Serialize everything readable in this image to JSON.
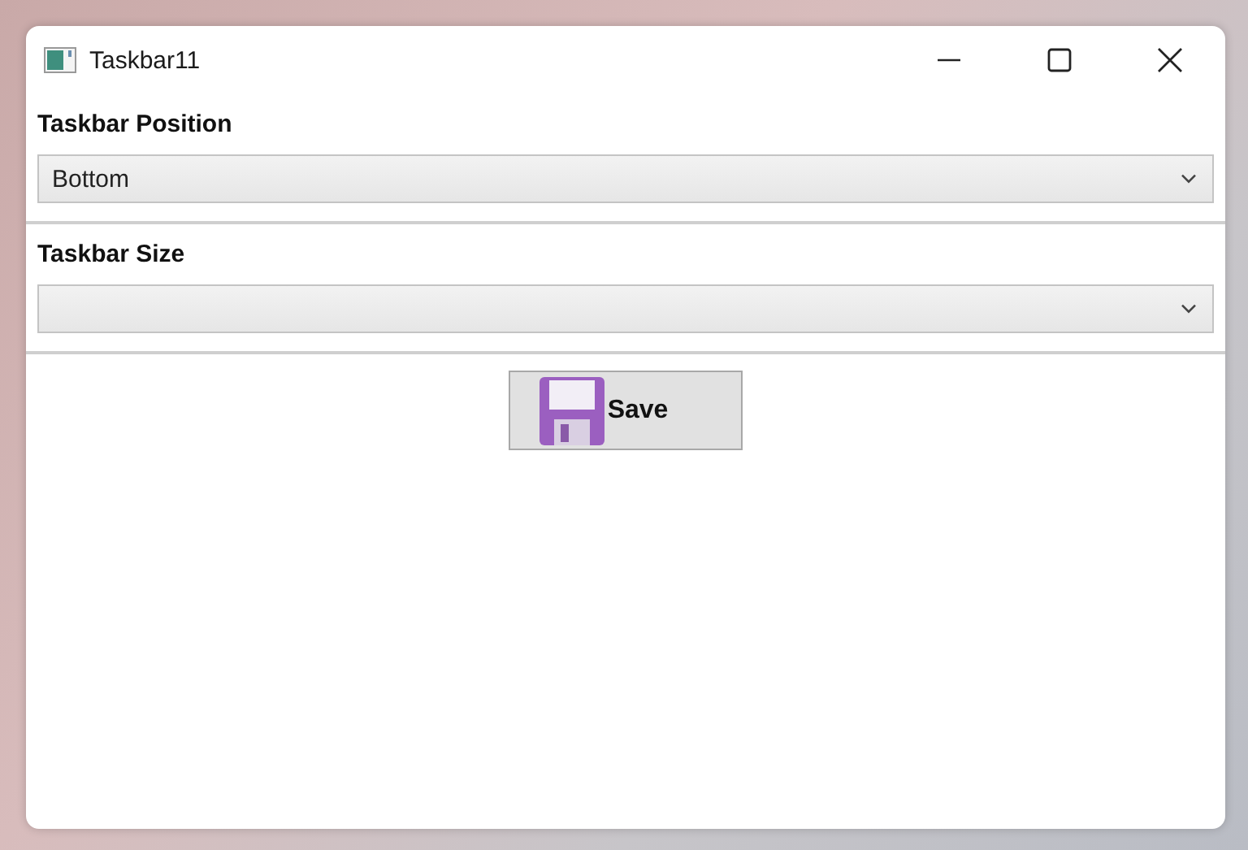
{
  "window": {
    "title": "Taskbar11"
  },
  "settings": [
    {
      "label": "Taskbar Position",
      "value": "Bottom"
    },
    {
      "label": "Taskbar Size"
    }
  ],
  "save_button": {
    "label": "Save"
  }
}
